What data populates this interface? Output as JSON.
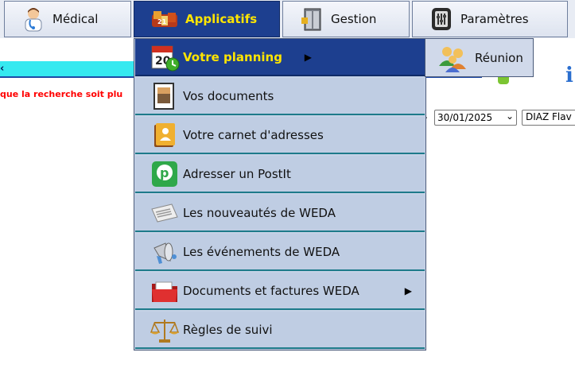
{
  "nav": {
    "tabs": [
      {
        "label": "Médical",
        "icon": "doctor-icon"
      },
      {
        "label": "Applicatifs",
        "icon": "applications-icon"
      },
      {
        "label": "Gestion",
        "icon": "cabinet-icon"
      },
      {
        "label": "Paramètres",
        "icon": "settings-panel-icon"
      }
    ]
  },
  "background": {
    "warning_text": "que la recherche soit plu",
    "date_value": "30/01/2025",
    "name_value": "DIAZ Flav"
  },
  "menu": {
    "items": [
      {
        "label": "Votre planning",
        "icon": "calendar-icon",
        "has_submenu": true
      },
      {
        "label": "Vos documents",
        "icon": "photo-document-icon"
      },
      {
        "label": "Votre carnet d'adresses",
        "icon": "address-book-icon"
      },
      {
        "label": "Adresser un PostIt",
        "icon": "postit-icon"
      },
      {
        "label": "Les nouveautés de WEDA",
        "icon": "news-icon"
      },
      {
        "label": "Les événements de WEDA",
        "icon": "megaphone-icon"
      },
      {
        "label": "Documents et factures WEDA",
        "icon": "folder-icon",
        "has_submenu": true
      },
      {
        "label": "Règles de suivi",
        "icon": "scales-icon"
      }
    ],
    "arrow_glyph": "▶"
  },
  "submenu": {
    "label": "Réunion",
    "icon": "meeting-people-icon"
  },
  "colors": {
    "active_bg": "#1d3f8f",
    "active_text": "#ffe500",
    "menu_bg": "#bfcde3",
    "strip": "#36e9f0",
    "warning": "#ff0000"
  }
}
